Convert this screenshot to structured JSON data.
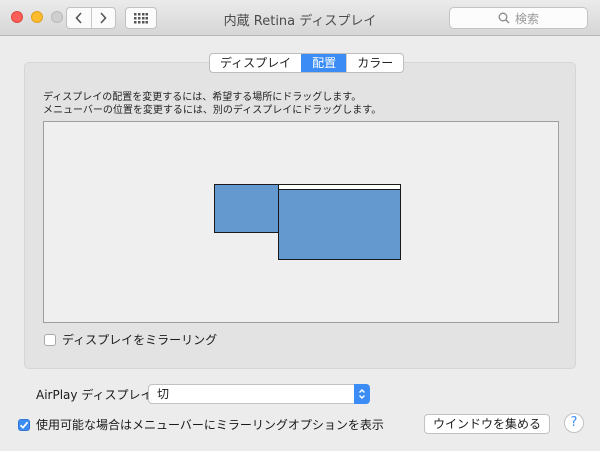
{
  "window": {
    "title": "内蔵 Retina ディスプレイ"
  },
  "toolbar": {
    "back_icon": "chevron-left-icon",
    "forward_icon": "chevron-right-icon",
    "grid_icon": "grid-icon",
    "search_placeholder": "検索"
  },
  "tabs": [
    {
      "label": "ディスプレイ",
      "active": false
    },
    {
      "label": "配置",
      "active": true
    },
    {
      "label": "カラー",
      "active": false
    }
  ],
  "arrangement": {
    "instruction_line1": "ディスプレイの配置を変更するには、希望する場所にドラッグします。",
    "instruction_line2": "メニューバーの位置を変更するには、別のディスプレイにドラッグします。",
    "display_color": "#6499d0"
  },
  "mirror": {
    "label": "ディスプレイをミラーリング",
    "checked": false
  },
  "airplay": {
    "label": "AirPlay ディスプレイ：",
    "value": "切"
  },
  "show_in_menubar": {
    "label": "使用可能な場合はメニューバーにミラーリングオプションを表示",
    "checked": true
  },
  "buttons": {
    "gather_windows": "ウインドウを集める",
    "help": "?"
  },
  "colors": {
    "accent": "#3b8cf5"
  }
}
